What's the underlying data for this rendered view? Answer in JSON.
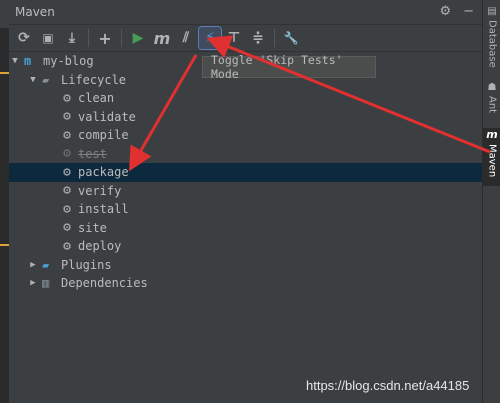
{
  "header": {
    "title": "Maven",
    "icons": [
      "gear-icon",
      "hide-icon"
    ]
  },
  "toolbar": {
    "buttons": [
      {
        "name": "reload-icon",
        "glyph": "⟳"
      },
      {
        "name": "generate-sources-icon",
        "glyph": "▣"
      },
      {
        "name": "download-icon",
        "glyph": "⤓"
      },
      {
        "name": "add-icon",
        "glyph": "+"
      },
      {
        "name": "run-icon",
        "glyph": "▶"
      },
      {
        "name": "execute-goal-icon",
        "glyph": "m"
      },
      {
        "name": "toggle-offline-icon",
        "glyph": "⫽"
      },
      {
        "name": "skip-tests-icon",
        "glyph": "⚡"
      },
      {
        "name": "show-dependencies-icon",
        "glyph": "⊤"
      },
      {
        "name": "collapse-all-icon",
        "glyph": "≑"
      },
      {
        "name": "settings-wrench-icon",
        "glyph": "🔧"
      }
    ],
    "tooltip": "Toggle 'Skip Tests' Mode"
  },
  "tree": {
    "project": "my-blog",
    "lifecycle_label": "Lifecycle",
    "goals": [
      "clean",
      "validate",
      "compile",
      "test",
      "package",
      "verify",
      "install",
      "site",
      "deploy"
    ],
    "plugins_label": "Plugins",
    "dependencies_label": "Dependencies"
  },
  "sidebar": {
    "tabs": [
      "Database",
      "Ant",
      "Maven"
    ]
  },
  "watermark": "https://blog.csdn.net/a44185",
  "colors": {
    "background": "#3c3f41",
    "selection": "#0d293e",
    "run_green": "#499c54",
    "skip_tests_blue": "#4a9fd8",
    "annotation_red": "#e03030"
  }
}
